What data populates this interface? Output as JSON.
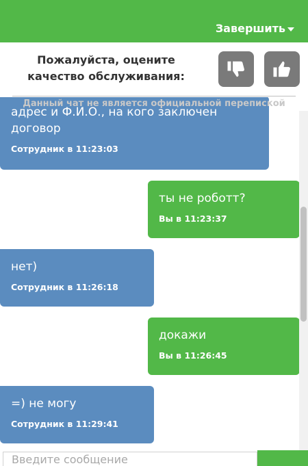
{
  "header": {
    "end_label": "Завершить",
    "accent_color": "#52b848"
  },
  "rating": {
    "prompt": "Пожалуйста, оцените качество обслуживания:",
    "dislike_icon": "thumbs-down-icon",
    "like_icon": "thumbs-up-icon"
  },
  "chat": {
    "notice": "Данный чат не является официальной перепиской",
    "messages": [
      {
        "author": "operator",
        "text": "адрес и Ф.И.О., на кого заключен договор",
        "meta": "Сотрудник в 11:23:03"
      },
      {
        "author": "user",
        "text": "ты не роботт?",
        "meta": "Вы в 11:23:37"
      },
      {
        "author": "operator",
        "text": "нет)",
        "meta": "Сотрудник в 11:26:18"
      },
      {
        "author": "user",
        "text": "докажи",
        "meta": "Вы в 11:26:45"
      },
      {
        "author": "operator",
        "text": "=) не могу",
        "meta": "Сотрудник в 11:29:41"
      }
    ]
  },
  "composer": {
    "placeholder": "Введите сообщение"
  },
  "colors": {
    "operator_bubble": "#5b8cbf",
    "user_bubble": "#52b848",
    "rate_button": "#7a7a7a"
  }
}
